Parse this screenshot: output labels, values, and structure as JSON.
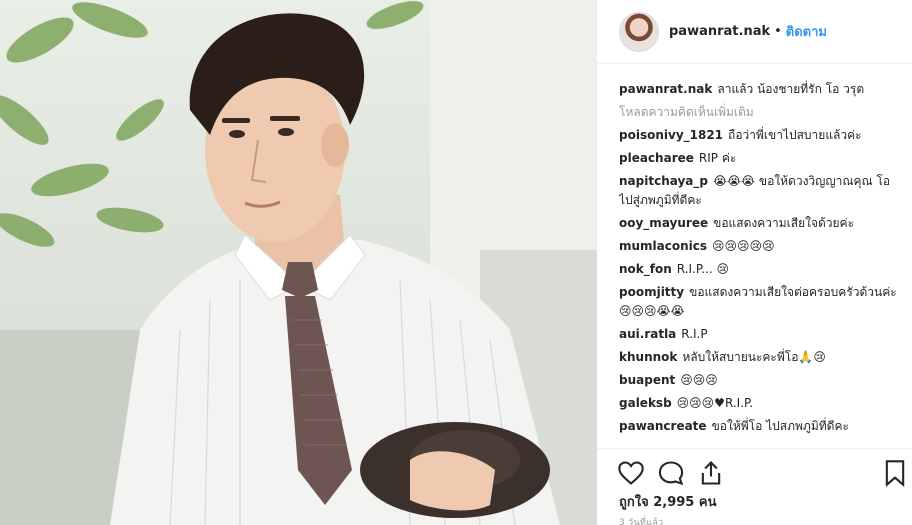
{
  "post": {
    "author": "pawanrat.nak",
    "separator": "•",
    "follow_label": "ติดตาม",
    "caption": "ลาแล้ว น้องชายที่รัก โอ วรุต",
    "load_more": "โหลดความคิดเห็นเพิ่มเติม",
    "likes": "ถูกใจ 2,995 คน",
    "time": "3 วันที่แล้ว"
  },
  "comments": [
    {
      "user": "poisonivy_1821",
      "text": "ถือว่าพี่เขาไปสบายแล้วค่ะ"
    },
    {
      "user": "pleacharee",
      "text": "RIP ค่ะ"
    },
    {
      "user": "napitchaya_p",
      "text": "😭😭😭 ขอให้ดวงวิญญาณคุณ โอ ไปสู่ภพภูมิที่ดีคะ"
    },
    {
      "user": "ooy_mayuree",
      "text": "ขอแสดงความเสียใจด้วยค่ะ"
    },
    {
      "user": "mumlaconics",
      "text": "😢😢😢😢😢"
    },
    {
      "user": "nok_fon",
      "text": "R.I.P... 😢"
    },
    {
      "user": "poomjitty",
      "text": "ขอแสดงความเสียใจต่อครอบครัวด้วนค่ะ 😢😢😢😭😭"
    },
    {
      "user": "aui.ratla",
      "text": "R.I.P"
    },
    {
      "user": "khunnok",
      "text": "หลับให้สบายนะคะพี่โอ🙏😢"
    },
    {
      "user": "buapent",
      "text": "😢😢😢"
    },
    {
      "user": "galeksb",
      "text": "😢😢😢♥R.I.P."
    },
    {
      "user": "pawancreate",
      "text": "ขอให้พี่โอ ไปสภพภูมิที่ดีคะ"
    }
  ],
  "icons": {
    "avatar": "avatar",
    "like": "heart-icon",
    "comment": "comment-icon",
    "share": "share-icon",
    "save": "bookmark-icon"
  },
  "colors": {
    "follow": "#3897f0",
    "muted": "#999999",
    "text": "#262626"
  }
}
